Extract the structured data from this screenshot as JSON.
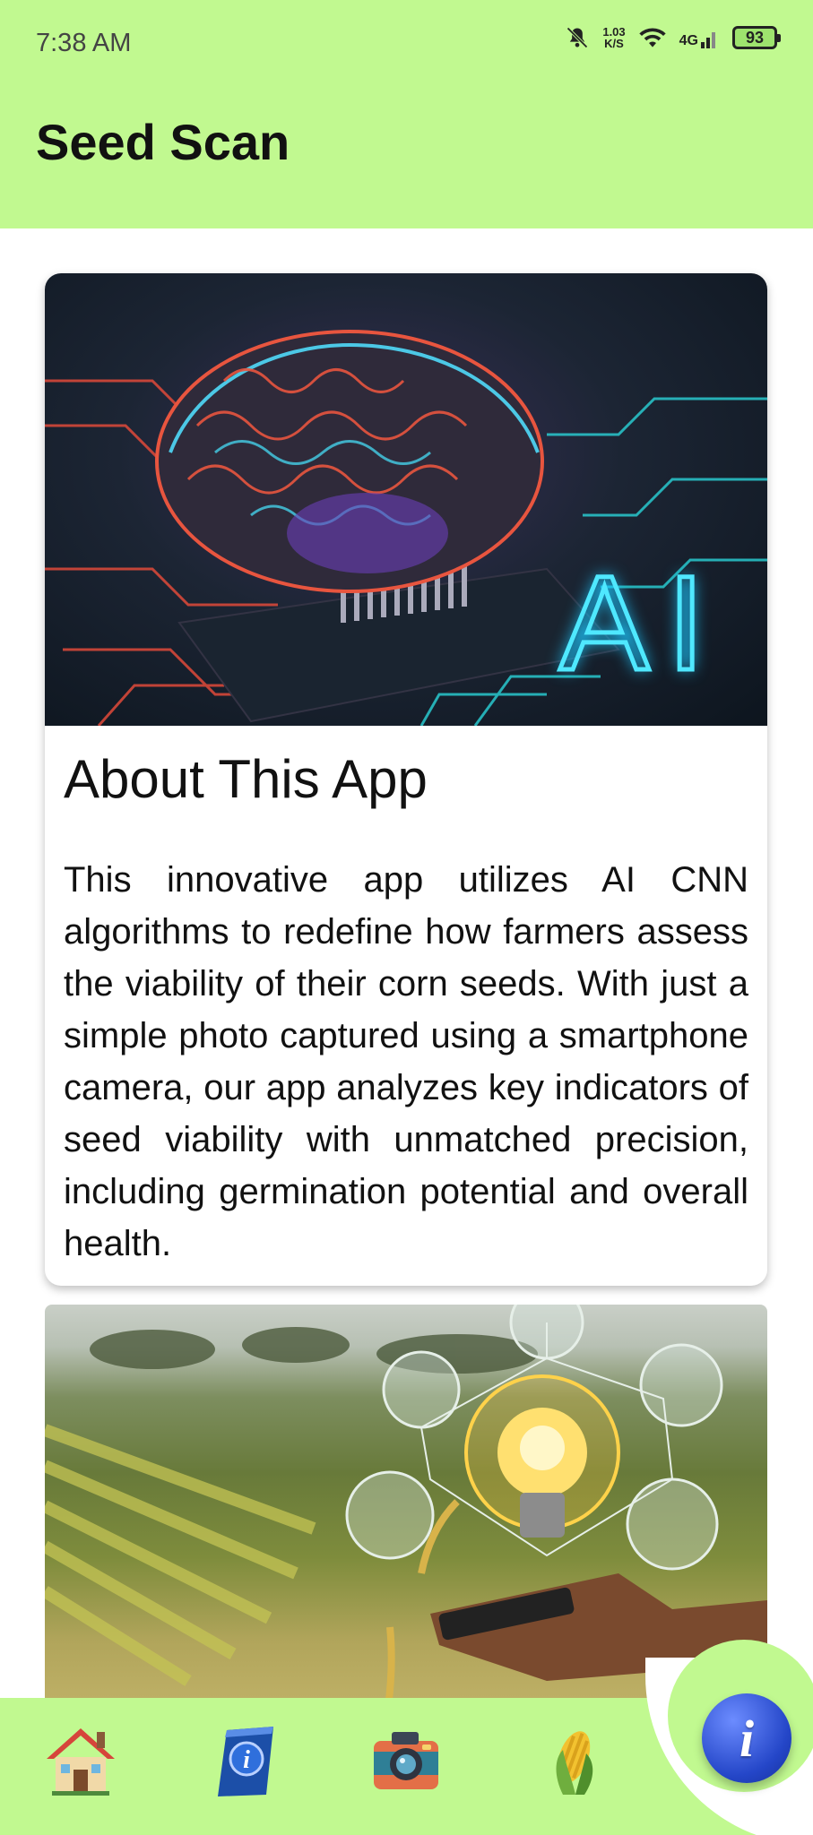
{
  "status_bar": {
    "time": "7:38 AM",
    "net_speed_value": "1.03",
    "net_speed_unit": "K/S",
    "network": "4G",
    "battery": "93",
    "icons": [
      "mute-bell-icon",
      "wifi-icon",
      "signal-icon",
      "battery-icon"
    ]
  },
  "app_bar": {
    "title": "Seed Scan"
  },
  "card_about": {
    "image_text": "AI",
    "title": "About This App",
    "body": "This innovative app utilizes AI CNN algorithms to redefine how farmers assess the viability of their corn seeds. With just a simple photo captured using a smartphone camera, our app analyzes key indicators of seed viability with unmatched precision, including germination potential and overall health."
  },
  "bottom_nav": {
    "items": [
      {
        "name": "home",
        "icon": "house-icon"
      },
      {
        "name": "guide",
        "icon": "info-book-icon"
      },
      {
        "name": "scan",
        "icon": "camera-icon"
      },
      {
        "name": "seeds",
        "icon": "corn-icon"
      }
    ],
    "fab_icon": "info-icon",
    "fab_glyph": "i"
  },
  "colors": {
    "accent": "#c1f990",
    "fab": "#2446c8"
  }
}
